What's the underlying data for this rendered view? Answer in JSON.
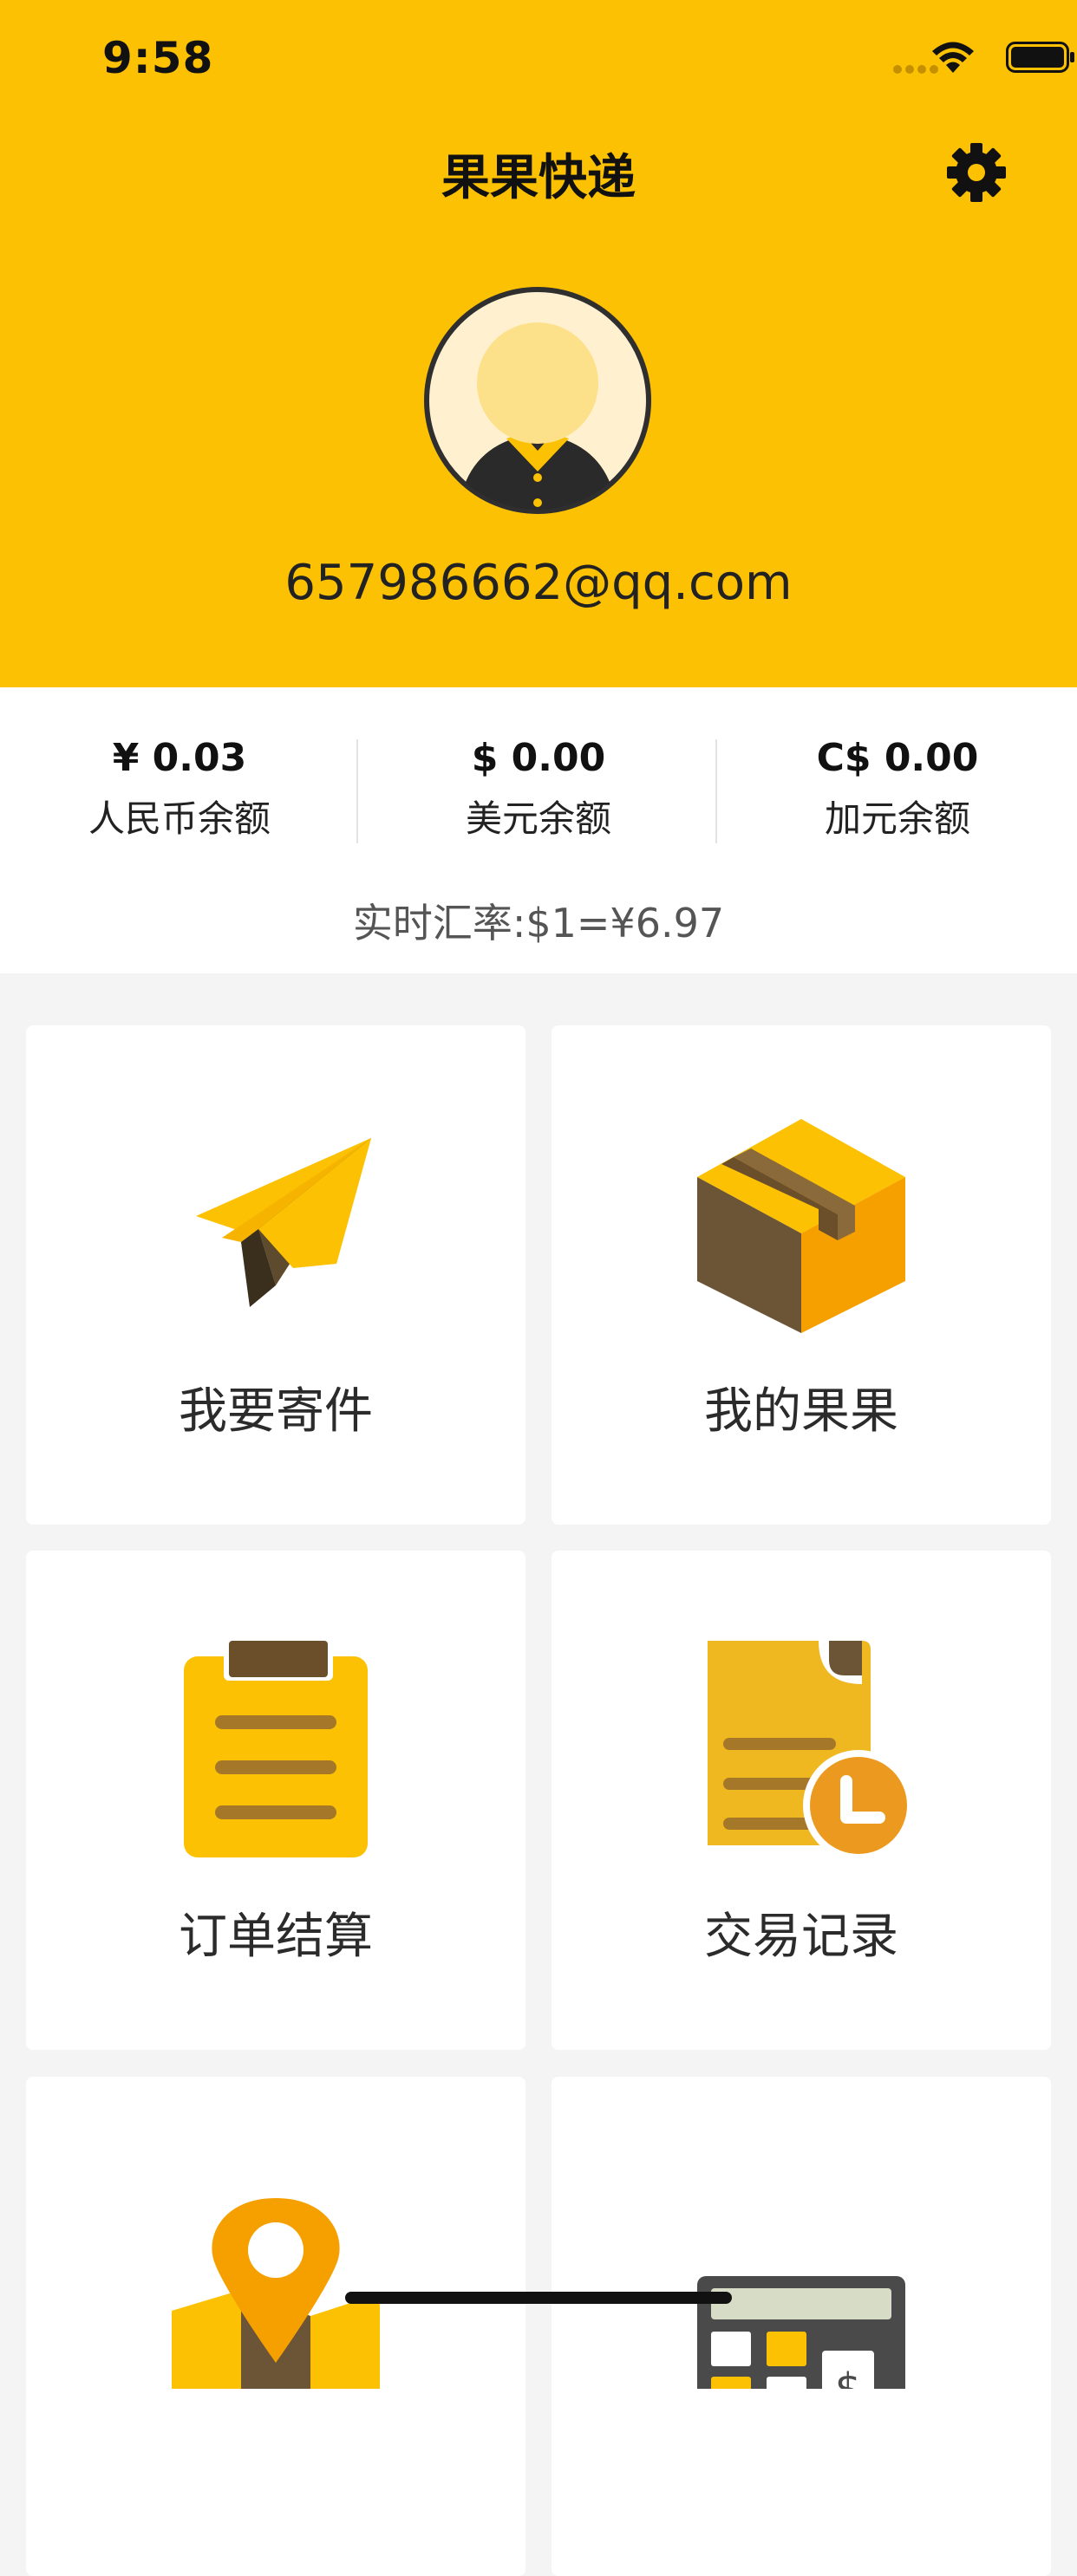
{
  "status_bar": {
    "time": "9:58"
  },
  "header": {
    "title": "果果快递",
    "email": "657986662@qq.com",
    "settings_icon": "gear-icon",
    "background_color": "#fcc102"
  },
  "balances": [
    {
      "amount": "¥ 0.03",
      "label": "人民币余额"
    },
    {
      "amount": "$ 0.00",
      "label": "美元余额"
    },
    {
      "amount": "C$ 0.00",
      "label": "加元余额"
    }
  ],
  "exchange_rate": "实时汇率:$1=¥6.97",
  "menu": [
    {
      "label": "我要寄件",
      "icon": "paper-plane-icon"
    },
    {
      "label": "我的果果",
      "icon": "package-box-icon"
    },
    {
      "label": "订单结算",
      "icon": "clipboard-icon"
    },
    {
      "label": "交易记录",
      "icon": "document-clock-icon"
    },
    {
      "label": "",
      "icon": "map-pin-icon"
    },
    {
      "label": "",
      "icon": "calculator-icon"
    }
  ],
  "colors": {
    "accent": "#fcc102",
    "brown": "#6b4e2a",
    "orange": "#f6a000"
  }
}
